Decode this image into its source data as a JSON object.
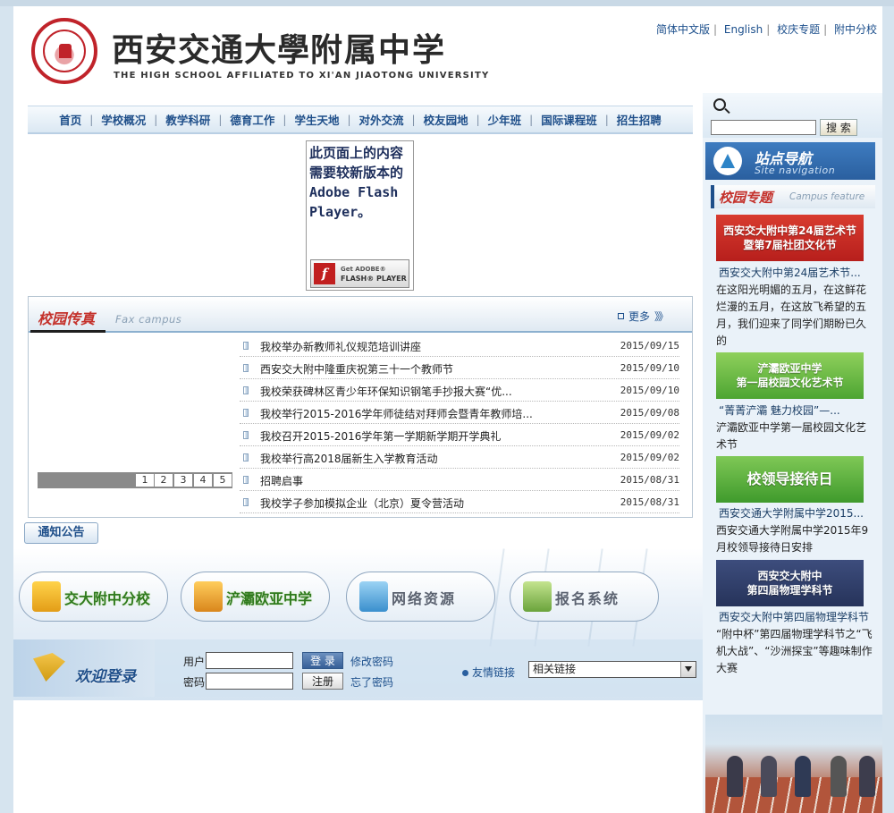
{
  "header": {
    "title_cn_script": "西安交通大學",
    "title_cn_bold": "附属中学",
    "title_en": "THE HIGH SCHOOL AFFILIATED TO XI'AN JIAOTONG UNIVERSITY",
    "logo_label": "XI'AN JIAOTONG UNIVERSITY"
  },
  "toplinks": [
    "简体中文版",
    "English",
    "校庆专题",
    "附中分校"
  ],
  "nav": [
    "首页",
    "学校概况",
    "教学科研",
    "德育工作",
    "学生天地",
    "对外交流",
    "校友园地",
    "少年班",
    "国际课程班",
    "招生招聘"
  ],
  "flash": {
    "message": "此页面上的内容需要较新版本的 Adobe Flash Player。",
    "badge_top": "Get ADOBE®",
    "badge_bottom": "FLASH® PLAYER",
    "badge_letter": "f"
  },
  "fax": {
    "title": "校园传真",
    "subtitle": "Fax campus",
    "more": "更多",
    "more_chev": "》》",
    "slides": [
      "1",
      "2",
      "3",
      "4",
      "5"
    ],
    "news": [
      {
        "title": "我校举办新教师礼仪规范培训讲座",
        "date": "2015/09/15"
      },
      {
        "title": "西安交大附中隆重庆祝第三十一个教师节",
        "date": "2015/09/10"
      },
      {
        "title": "我校荣获碑林区青少年环保知识钢笔手抄报大赛“优...",
        "date": "2015/09/10"
      },
      {
        "title": "我校举行2015-2016学年师徒结对拜师会暨青年教师培...",
        "date": "2015/09/08"
      },
      {
        "title": "我校召开2015-2016学年第一学期新学期开学典礼",
        "date": "2015/09/02"
      },
      {
        "title": "我校举行高2018届新生入学教育活动",
        "date": "2015/09/02"
      },
      {
        "title": "招聘启事",
        "date": "2015/08/31"
      },
      {
        "title": "我校学子参加模拟企业（北京）夏令营活动",
        "date": "2015/08/31"
      }
    ]
  },
  "notice_tab": "通知公告",
  "quicklinks": [
    "交大附中分校",
    "浐灞欧亚中学",
    "网络资源",
    "报名系统"
  ],
  "login": {
    "welcome": "欢迎登录",
    "user_label": "用户",
    "pass_label": "密码",
    "login_btn": "登 录",
    "register_btn": "注册",
    "change_pwd": "修改密码",
    "forgot_pwd": "忘了密码"
  },
  "friend_links": {
    "label": "友情链接",
    "selected": "相关链接"
  },
  "sidebar": {
    "search_btn": "搜 索",
    "site_nav_cn": "站点导航",
    "site_nav_en": "Site  navigation",
    "feature_cn": "校园专题",
    "feature_en": "Campus feature",
    "features": [
      {
        "img_line1": "西安交大附中第24届艺术节",
        "img_line2": "暨第7届社团文化节",
        "title": "西安交大附中第24届艺术节...",
        "desc": "在这阳光明媚的五月，在这鲜花烂漫的五月，在这放飞希望的五月，我们迎来了同学们期盼已久的"
      },
      {
        "img_line1": "浐灞欧亚中学",
        "img_line2": "第一届校园文化艺术节",
        "title": "“菁菁浐灞 魅力校园”—...",
        "desc": "浐灞欧亚中学第一届校园文化艺术节"
      },
      {
        "img_line1": "校领导接待日",
        "img_line2": "",
        "title": "西安交通大学附属中学2015...",
        "desc": "西安交通大学附属中学2015年9月校领导接待日安排"
      },
      {
        "img_line1": "西安交大附中",
        "img_line2": "第四届物理学科节",
        "title": "西安交大附中第四届物理学科节",
        "desc": "“附中杯”第四届物理学科节之“飞机大战”、“沙洲探宝”等趣味制作大赛"
      }
    ]
  },
  "colors": {
    "nav_text": "#1f4f8a",
    "accent_red": "#c4312b",
    "link_blue": "#1c4f8c"
  }
}
